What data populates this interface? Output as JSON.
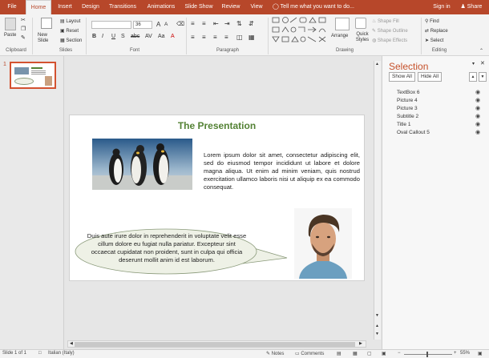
{
  "tabs": [
    "File",
    "Home",
    "Insert",
    "Design",
    "Transitions",
    "Animations",
    "Slide Show",
    "Review",
    "View"
  ],
  "tell_me": "Tell me what you want to do...",
  "sign_in": "Sign in",
  "share": "Share",
  "ribbon": {
    "paste": "Paste",
    "new_slide": "New Slide",
    "layout": "Layout",
    "reset": "Reset",
    "section": "Section",
    "font_size": "36",
    "arrange": "Arrange",
    "quick_styles": "Quick Styles",
    "shape_fill": "Shape Fill",
    "shape_outline": "Shape Outline",
    "shape_effects": "Shape Effects",
    "find": "Find",
    "replace": "Replace",
    "select": "Select",
    "groups": [
      "Clipboard",
      "Slides",
      "Font",
      "Paragraph",
      "Drawing",
      "Editing"
    ]
  },
  "thumb_number": "1",
  "slide": {
    "title": "The Presentation",
    "body": "Lorem ipsum dolor sit amet, consectetur adipiscing elit, sed do eiusmod tempor incididunt ut labore et dolore magna aliqua. Ut enim ad minim veniam, quis nostrud exercitation ullamco laboris nisi ut aliquip ex ea commodo consequat.",
    "callout": "Duis aute irure dolor in reprehenderit in voluptate velit esse cillum dolore eu fugiat nulla pariatur. Excepteur sint occaecat cupidatat non proident, sunt in culpa qui officia deserunt mollit anim id est laborum."
  },
  "selection": {
    "title": "Selection",
    "show_all": "Show All",
    "hide_all": "Hide All",
    "items": [
      "TextBox 6",
      "Picture 4",
      "Picture 3",
      "Subtitle 2",
      "Title 1",
      "Oval Callout 5"
    ]
  },
  "status": {
    "slide_of": "Slide 1 of 1",
    "language": "Italian (Italy)",
    "notes": "Notes",
    "comments": "Comments",
    "zoom": "55%"
  },
  "colors": {
    "brand": "#b7472a",
    "title_green": "#548235",
    "selection_title": "#c5502a"
  }
}
